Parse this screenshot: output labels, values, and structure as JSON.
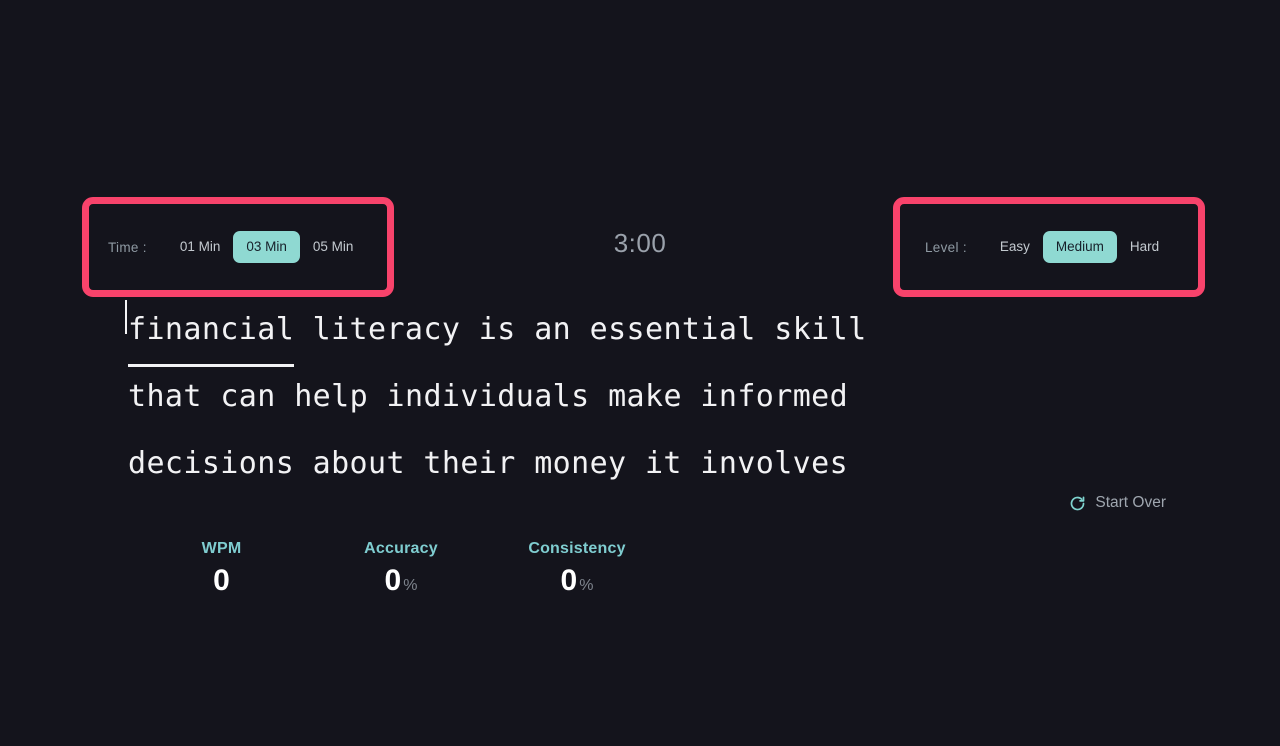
{
  "app": {
    "background_color": "#14141c",
    "accent_color": "#8fd9d2",
    "annotation_color": "#f8436b"
  },
  "time_selector": {
    "label": "Time :",
    "options": [
      {
        "label": "01 Min",
        "active": false
      },
      {
        "label": "03 Min",
        "active": true
      },
      {
        "label": "05 Min",
        "active": false
      }
    ],
    "selected": "03 Min"
  },
  "level_selector": {
    "label": "Level :",
    "options": [
      {
        "label": "Easy",
        "active": false
      },
      {
        "label": "Medium",
        "active": true
      },
      {
        "label": "Hard",
        "active": false
      }
    ],
    "selected": "Medium"
  },
  "timer": {
    "display": "3:00"
  },
  "passage": {
    "full_text": "financial literacy is an essential skill that can help individuals make informed decisions about their money it involves",
    "current_word": "financial",
    "lines": [
      {
        "words": [
          "financial",
          "literacy",
          "is",
          "an",
          "essential",
          "skill"
        ]
      },
      {
        "words": [
          "that",
          "can",
          "help",
          "individuals",
          "make",
          "informed"
        ]
      },
      {
        "words": [
          "decisions",
          "about",
          "their",
          "money",
          "it",
          "involves"
        ]
      }
    ]
  },
  "start_over": {
    "label": "Start Over",
    "icon": "refresh-icon"
  },
  "stats": [
    {
      "label": "WPM",
      "value": "0",
      "unit": ""
    },
    {
      "label": "Accuracy",
      "value": "0",
      "unit": "%"
    },
    {
      "label": "Consistency",
      "value": "0",
      "unit": "%"
    }
  ]
}
